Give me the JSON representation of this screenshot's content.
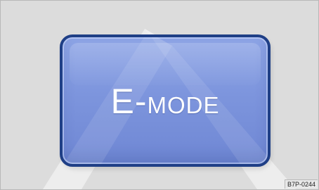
{
  "button": {
    "text_large": "E-",
    "text_small": "MODE"
  },
  "reference_code": "B7P-0244",
  "colors": {
    "background": "#dcdcdc",
    "button_fill": "#7d95dd",
    "button_border": "#1f3f86",
    "text": "#ffffff"
  }
}
